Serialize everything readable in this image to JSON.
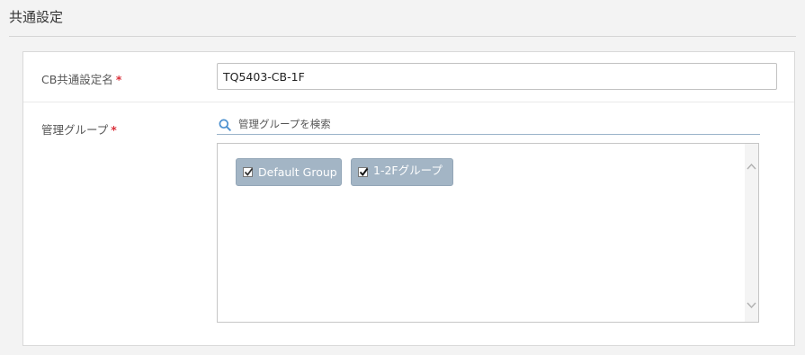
{
  "section": {
    "title": "共通設定"
  },
  "form": {
    "name_label": "CB共通設定名",
    "name_value": "TQ5403-CB-1F",
    "group_label": "管理グループ",
    "required_mark": "*",
    "search_placeholder": "管理グループを検索",
    "groups": [
      {
        "label": "Default Group",
        "checked": true
      },
      {
        "label": "1-2Fグループ",
        "checked": true
      }
    ]
  },
  "colors": {
    "required": "#d9303a",
    "chip_background": "#a3b5c5",
    "search_icon": "#4a8fcf"
  },
  "icons": {
    "search": "search-icon",
    "checkbox": "checkbox-checked-icon",
    "scroll_up": "chevron-up-icon",
    "scroll_down": "chevron-down-icon"
  }
}
